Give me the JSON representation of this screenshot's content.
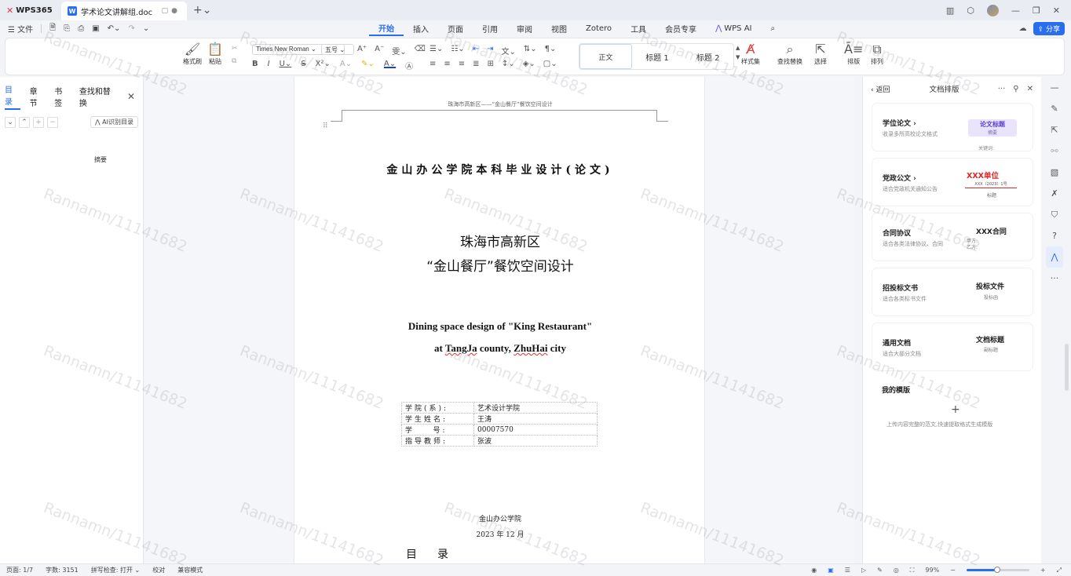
{
  "titlebar": {
    "app_tab": "WPS365",
    "doc_tab": "学术论文讲解组.doc",
    "doc_icon_letter": "W"
  },
  "menubar": {
    "file": "文件",
    "tabs": [
      "开始",
      "插入",
      "页面",
      "引用",
      "审阅",
      "视图",
      "Zotero",
      "工具",
      "会员专享"
    ],
    "ai": "WPS AI",
    "share": "分享"
  },
  "ribbon": {
    "format_painter": "格式刷",
    "paste": "粘贴",
    "font": "Times New Roman",
    "size": "五号",
    "styles": [
      "正文",
      "标题 1",
      "标题 2"
    ],
    "style_set": "样式集",
    "find_replace": "查找替换",
    "select": "选择",
    "layout": "排版",
    "arrange": "排列"
  },
  "leftpane": {
    "tabs": [
      "目录",
      "章节",
      "书签",
      "查找和替换"
    ],
    "ai_toc": "AI识别目录",
    "toc_items": [
      "摘要"
    ]
  },
  "document": {
    "running_head": "珠海市高新区——“金山餐厅”餐饮空间设计",
    "title": "金山办公学院本科毕业设计(论文)",
    "cn_title_line1": "珠海市高新区",
    "cn_title_line2": "“金山餐厅”餐饮空间设计",
    "en_line1": "Dining space design of \"King Restaurant\"",
    "en_line2_prefix": "at ",
    "en_line2_word1": "TangJa",
    "en_line2_mid": " county, ",
    "en_line2_word2": "ZhuHai",
    "en_line2_suffix": " city",
    "info": [
      {
        "k": "学院(系):",
        "v": "艺术设计学院"
      },
      {
        "k": "学生姓名:",
        "v": "王涛"
      },
      {
        "k": "学    号:",
        "v": "00007570"
      },
      {
        "k": "指导教师:",
        "v": "张波"
      }
    ],
    "institution": "金山办公学院",
    "date": "2023 年 12 月",
    "toc_heading": "目录"
  },
  "rightpanel": {
    "back": "返回",
    "title": "文档排版",
    "cards": [
      {
        "title": "学位论文",
        "sub": "收录多所高校论文格式",
        "thumb_title": "论文标题",
        "thumb_sub": "摘要",
        "under": "关键词:"
      },
      {
        "title": "党政公文",
        "sub": "适合党政机关通知公告",
        "thumb_title": "XXX单位",
        "thumb_sub": "XXX〔2023〕1号",
        "under": "标题"
      },
      {
        "title": "合同协议",
        "sub": "适合各类法律协议、合同",
        "thumb_title": "XXX合同",
        "thumb_sub": "甲方:",
        "thumb_sub2": "乙方:"
      },
      {
        "title": "招投标文书",
        "sub": "适合各类标书文件",
        "thumb_title": "投标文件",
        "thumb_sub": "投标函"
      },
      {
        "title": "通用文档",
        "sub": "适合大部分文档",
        "thumb_title": "文档标题",
        "thumb_sub": "副标题"
      }
    ],
    "my_templates": "我的模版",
    "my_templates_hint": "上传内容完整的范文,快速提取格式生成模版"
  },
  "statusbar": {
    "page": "页面: 1/7",
    "words": "字数: 3151",
    "spell": "拼写检查: 打开",
    "proof": "校对",
    "compat": "兼容模式",
    "zoom": "99%",
    "zoom_fraction": 0.48
  },
  "watermark": "Rannamn/11141682",
  "colors": {
    "accent": "#2a6ef0",
    "brand_red": "#e8333a"
  }
}
